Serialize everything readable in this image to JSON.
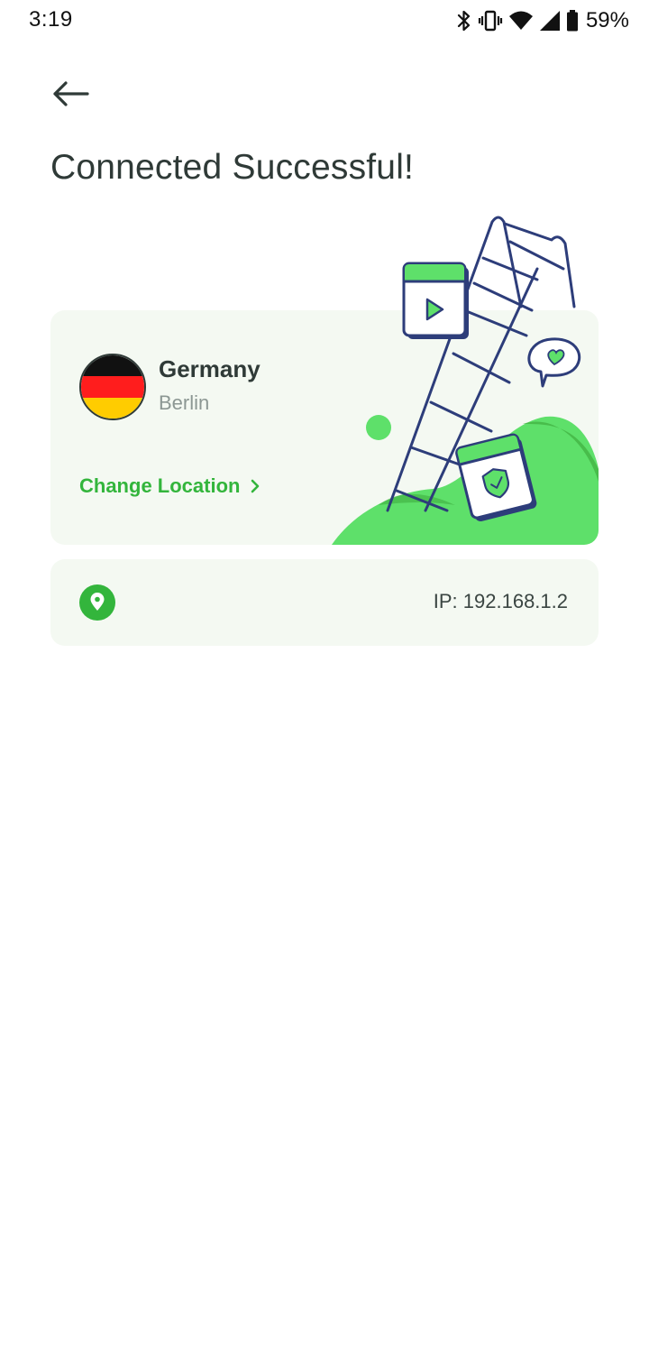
{
  "status_bar": {
    "time": "3:19",
    "battery_percent": "59%",
    "icons": [
      "bluetooth-icon",
      "vibrate-icon",
      "wifi-icon",
      "cell-signal-icon",
      "battery-icon"
    ]
  },
  "header": {
    "back_icon": "arrow-left-icon",
    "title": "Connected Successful!"
  },
  "location": {
    "country": "Germany",
    "city": "Berlin",
    "flag_colors": [
      "#111111",
      "#ff1d1d",
      "#ffcc00"
    ],
    "change_label": "Change Location",
    "change_icon": "chevron-right-icon"
  },
  "ip_info": {
    "icon": "location-pin-icon",
    "text": "IP: 192.168.1.2"
  },
  "colors": {
    "accent_green": "#33b53c",
    "card_bg": "#f4f9f2",
    "title_text": "#2f3a37",
    "illustration_navy": "#2d3d7a",
    "illustration_green": "#5ee06a"
  }
}
